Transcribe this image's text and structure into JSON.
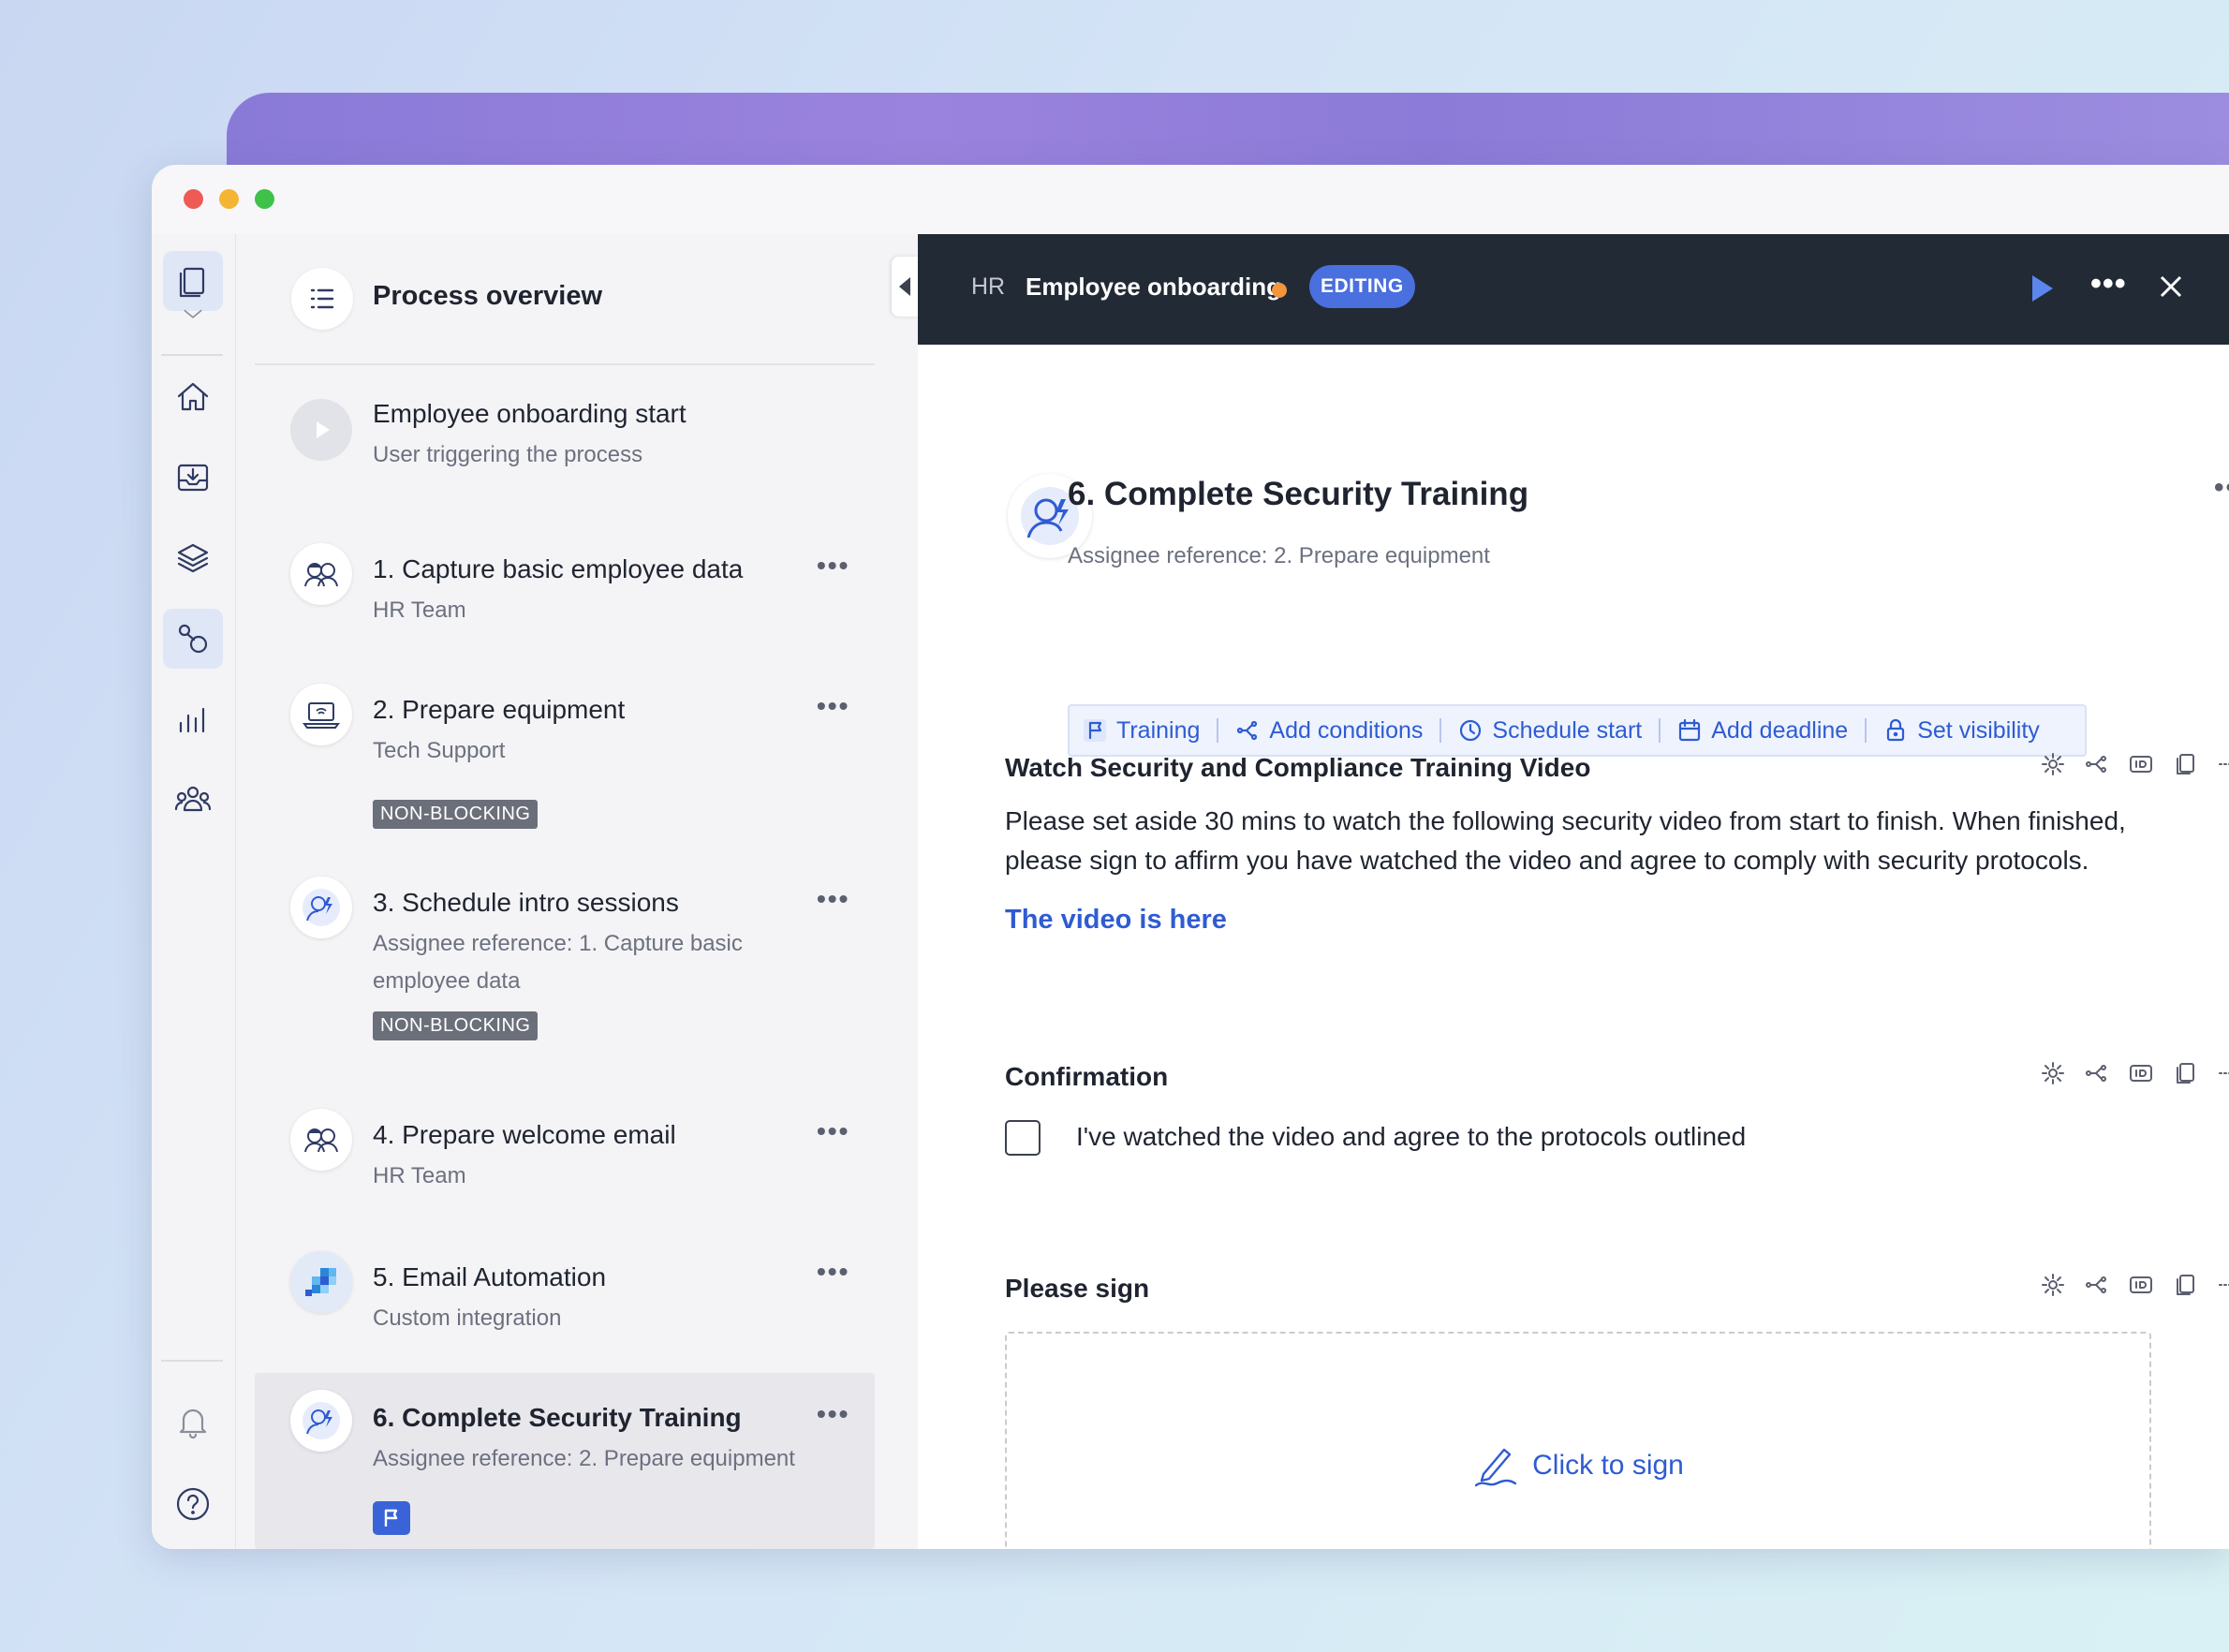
{
  "sidebar_rail": {
    "items": [
      "documents-icon",
      "chevron-down-icon",
      "home-icon",
      "inbox-icon",
      "layers-icon",
      "workflow-icon",
      "analytics-icon",
      "team-icon",
      "bell-icon",
      "help-icon",
      "avatar"
    ]
  },
  "process_list": {
    "overview_title": "Process overview",
    "start": {
      "title": "Employee onboarding start",
      "subtitle": "User triggering the process"
    },
    "steps": [
      {
        "title": "1. Capture basic employee data",
        "subtitle": "HR Team",
        "icon": "team-people-icon"
      },
      {
        "title": "2. Prepare equipment",
        "subtitle": "Tech Support",
        "badge": "NON-BLOCKING",
        "icon": "laptop-icon"
      },
      {
        "title": "3. Schedule intro sessions",
        "subtitle": "Assignee reference: 1. Capture basic employee data",
        "badge": "NON-BLOCKING",
        "icon": "assignee-reference-icon"
      },
      {
        "title": "4. Prepare welcome email",
        "subtitle": "HR Team",
        "icon": "team-people-icon"
      },
      {
        "title": "5. Email Automation",
        "subtitle": "Custom integration",
        "icon": "integration-icon"
      },
      {
        "title": "6. Complete Security Training",
        "subtitle": "Assignee reference: 2. Prepare equipment",
        "icon": "assignee-reference-icon",
        "selected": true
      }
    ],
    "more_label": "•••"
  },
  "topbar": {
    "breadcrumb": "HR",
    "process_name": "Employee onboarding",
    "status_badge": "EDITING",
    "more_label": "•••"
  },
  "task": {
    "title": "6. Complete Security Training",
    "subtitle": "Assignee reference: 2. Prepare equipment",
    "more_label": "•••",
    "chips": [
      "Training",
      "Add conditions",
      "Schedule start",
      "Add deadline",
      "Set visibility"
    ]
  },
  "sections": {
    "video": {
      "title": "Watch Security and Compliance Training Video",
      "body": "Please set aside 30 mins to watch the following security video from start to finish. When finished, please sign to affirm you have watched the video and agree to comply with security protocols.",
      "link": "The video is here"
    },
    "confirmation": {
      "title": "Confirmation",
      "checkbox_label": "I've watched the video and agree to the protocols outlined"
    },
    "signature": {
      "title": "Please sign",
      "button": "Click to sign"
    }
  },
  "colors": {
    "accent": "#2f5bd3",
    "topbar": "#222a35",
    "editing_badge": "#4a6fde",
    "unsaved_dot": "#f2953c",
    "delete": "#e24c4c",
    "non_blocking_badge": "#6b6f7a"
  }
}
